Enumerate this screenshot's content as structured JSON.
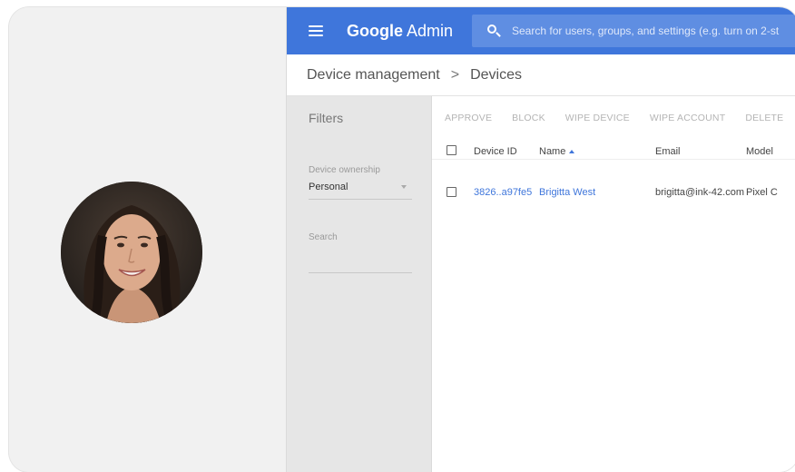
{
  "header": {
    "app_name_bold": "Google",
    "app_name_rest": " Admin",
    "search_placeholder": "Search for users, groups, and settings (e.g. turn on 2-st"
  },
  "breadcrumb": {
    "parent": "Device management",
    "separator": ">",
    "current": "Devices"
  },
  "filters": {
    "title": "Filters",
    "ownership_label": "Device ownership",
    "ownership_value": "Personal",
    "search_label": "Search"
  },
  "actions": [
    "APPROVE",
    "BLOCK",
    "WIPE DEVICE",
    "WIPE ACCOUNT",
    "DELETE"
  ],
  "table": {
    "columns": {
      "device_id": "Device ID",
      "name": "Name",
      "email": "Email",
      "model": "Model"
    },
    "rows": [
      {
        "device_id": "3826..a97fe5",
        "name": "Brigitta West",
        "email": "brigitta@ink-42.com",
        "model": "Pixel C"
      }
    ]
  },
  "colors": {
    "topbar": "#3f76db",
    "link": "#3f76db",
    "filters_bg": "#e6e6e6"
  }
}
